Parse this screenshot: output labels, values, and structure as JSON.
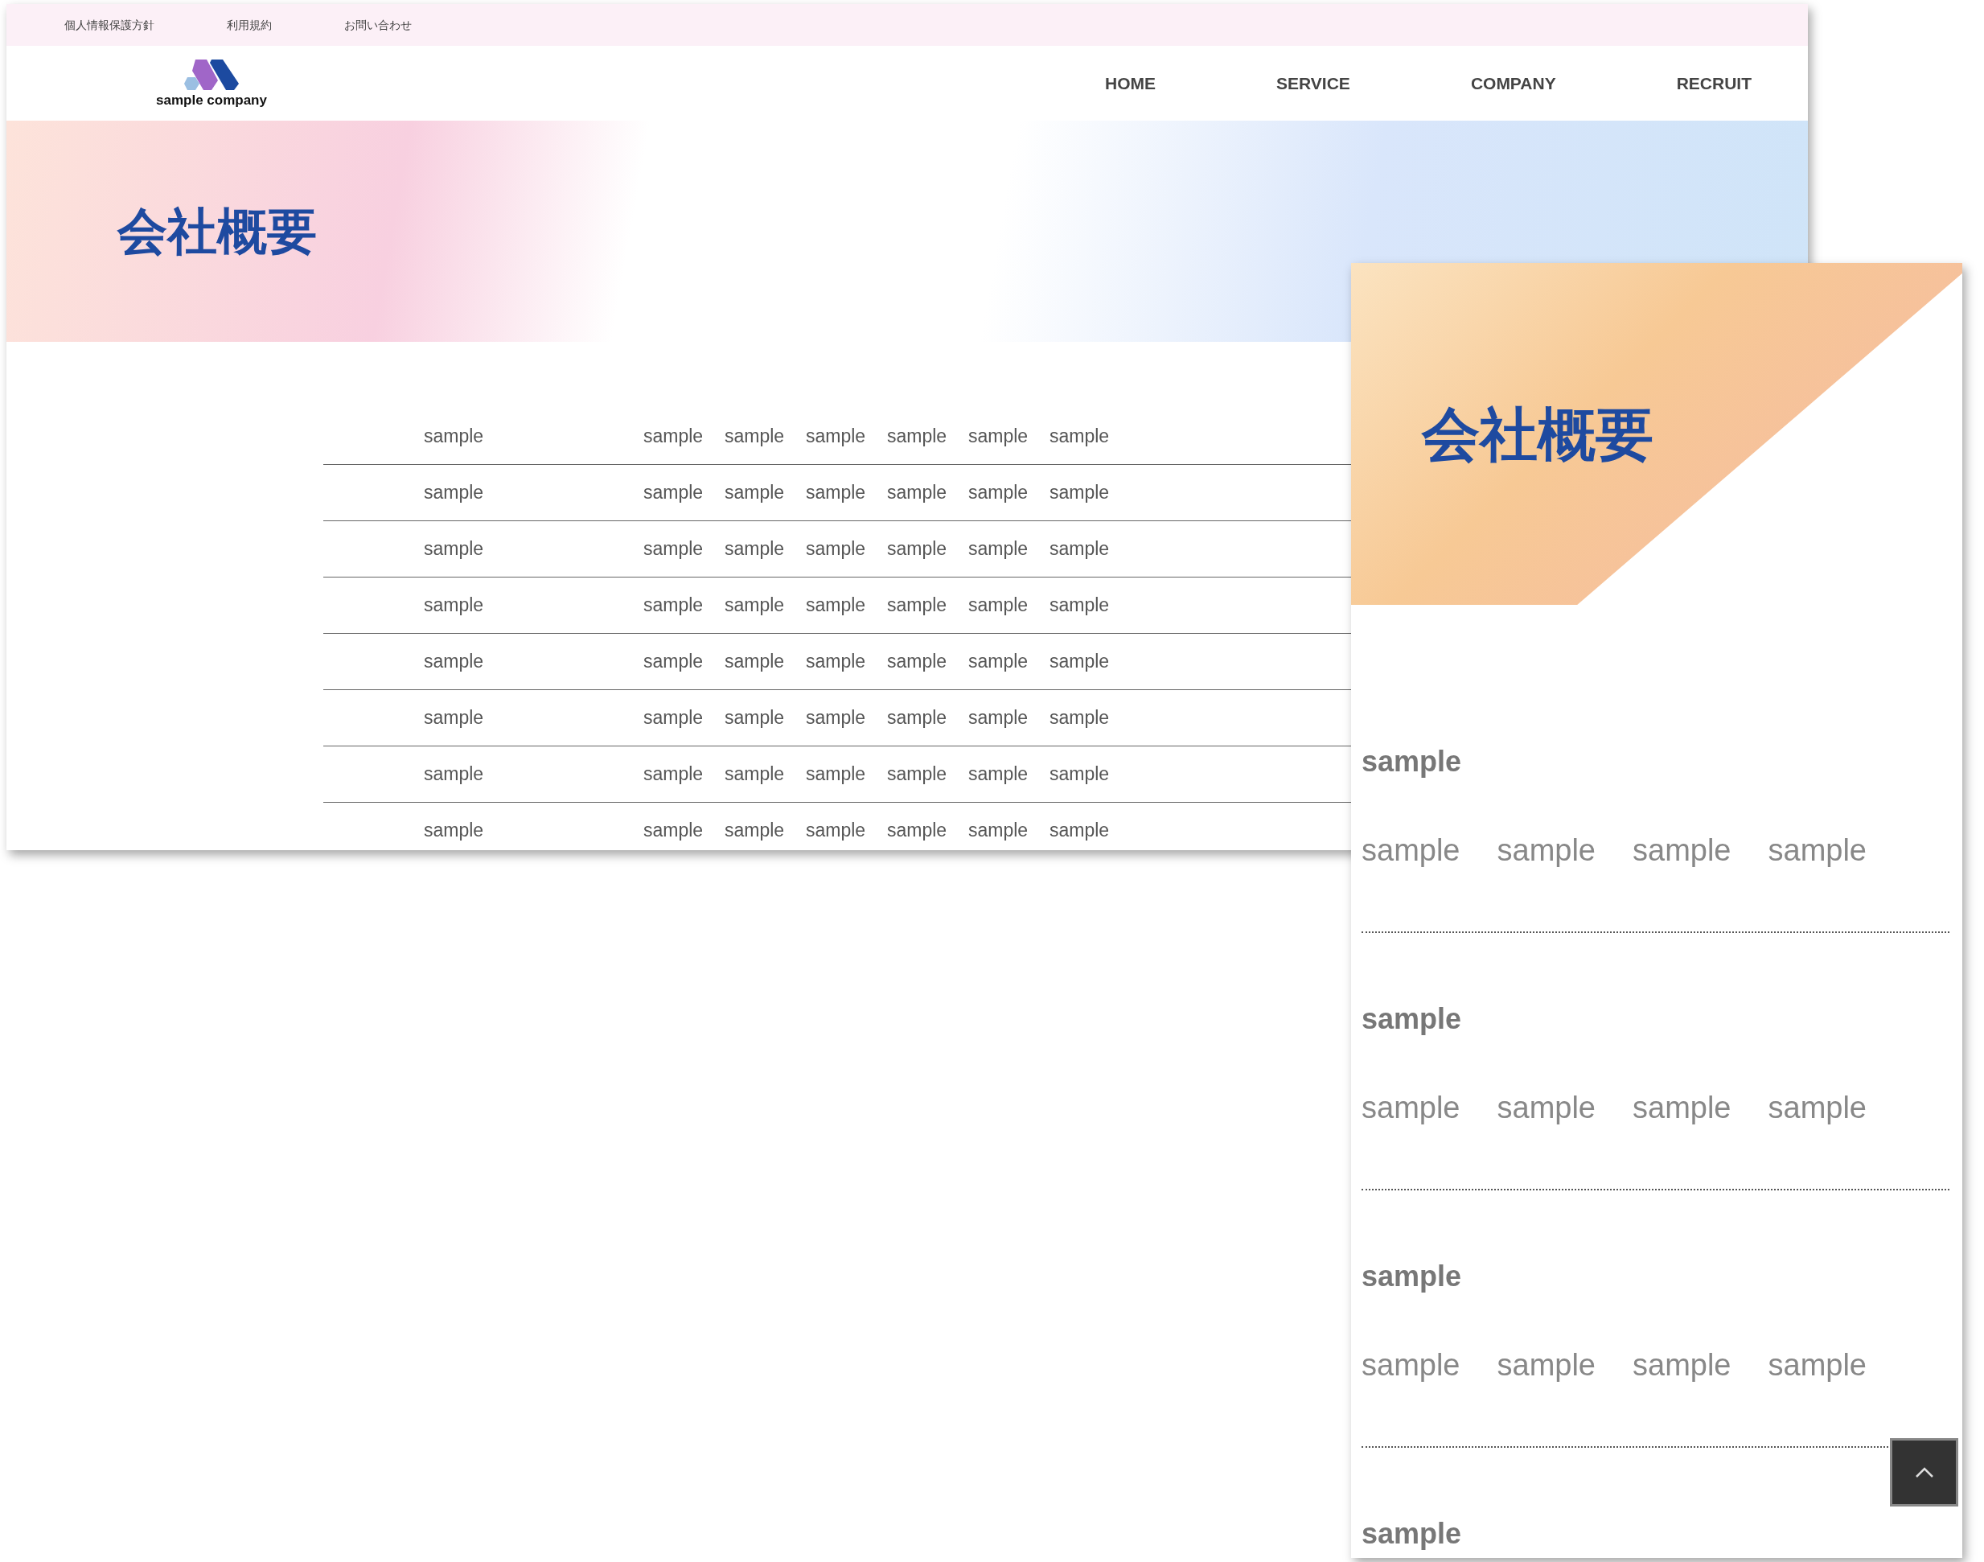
{
  "desktop": {
    "top_links": [
      "個人情報保護方針",
      "利用規約",
      "お問い合わせ"
    ],
    "logo": {
      "text": "sample company"
    },
    "nav": [
      {
        "label": "HOME"
      },
      {
        "label": "SERVICE"
      },
      {
        "label": "COMPANY"
      },
      {
        "label": "RECRUIT"
      }
    ],
    "hero_title": "会社概要",
    "table_rows": [
      {
        "cells": [
          "sample",
          "sample",
          "sample",
          "sample",
          "sample",
          "sample",
          "sample"
        ]
      },
      {
        "cells": [
          "sample",
          "sample",
          "sample",
          "sample",
          "sample",
          "sample",
          "sample"
        ]
      },
      {
        "cells": [
          "sample",
          "sample",
          "sample",
          "sample",
          "sample",
          "sample",
          "sample"
        ]
      },
      {
        "cells": [
          "sample",
          "sample",
          "sample",
          "sample",
          "sample",
          "sample",
          "sample"
        ]
      },
      {
        "cells": [
          "sample",
          "sample",
          "sample",
          "sample",
          "sample",
          "sample",
          "sample"
        ]
      },
      {
        "cells": [
          "sample",
          "sample",
          "sample",
          "sample",
          "sample",
          "sample",
          "sample"
        ]
      },
      {
        "cells": [
          "sample",
          "sample",
          "sample",
          "sample",
          "sample",
          "sample",
          "sample"
        ]
      },
      {
        "cells": [
          "sample",
          "sample",
          "sample",
          "sample",
          "sample",
          "sample",
          "sample"
        ]
      }
    ]
  },
  "mobile": {
    "hero_title": "会社概要",
    "sections": [
      {
        "heading": "sample",
        "items": [
          "sample",
          "sample",
          "sample",
          "sample"
        ]
      },
      {
        "heading": "sample",
        "items": [
          "sample",
          "sample",
          "sample",
          "sample"
        ]
      },
      {
        "heading": "sample",
        "items": [
          "sample",
          "sample",
          "sample",
          "sample"
        ]
      },
      {
        "heading": "sample"
      }
    ]
  }
}
